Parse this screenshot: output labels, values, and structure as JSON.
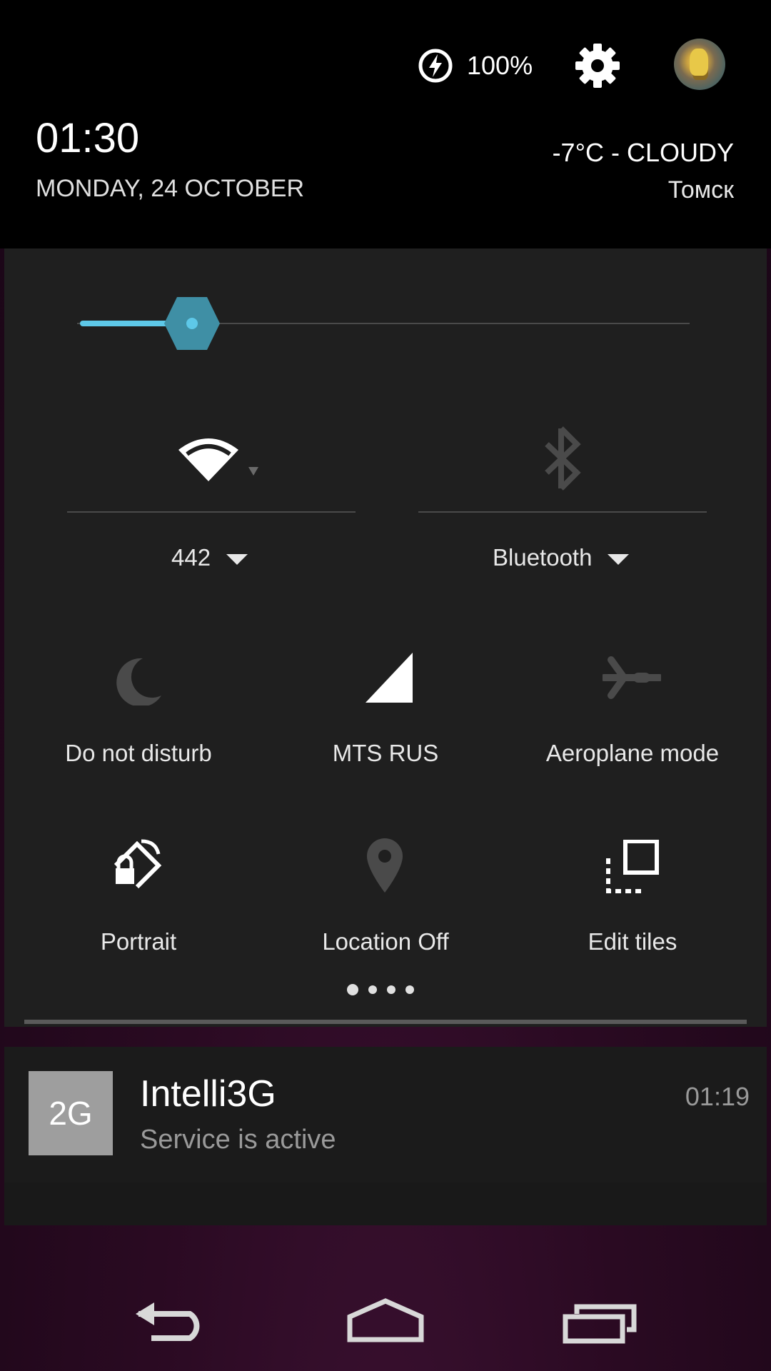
{
  "status": {
    "battery_text": "100%",
    "time": "01:30",
    "date": "MONDAY, 24 OCTOBER",
    "weather": "-7°C - CLOUDY",
    "city": "Томск"
  },
  "brightness": {
    "level_fraction": 0.15,
    "accent_color": "#5ec8e8"
  },
  "toggles": {
    "wifi": {
      "label": "442",
      "icon": "wifi-icon",
      "state": "on"
    },
    "bluetooth": {
      "label": "Bluetooth",
      "icon": "bluetooth-icon",
      "state": "off"
    }
  },
  "tiles": [
    {
      "label": "Do not disturb",
      "icon": "moon-icon",
      "state": "off"
    },
    {
      "label": "MTS RUS",
      "icon": "cell-signal-icon",
      "state": "on"
    },
    {
      "label": "Aeroplane mode",
      "icon": "airplane-icon",
      "state": "off"
    },
    {
      "label": "Portrait",
      "icon": "rotation-lock-icon",
      "state": "on"
    },
    {
      "label": "Location Off",
      "icon": "location-pin-icon",
      "state": "off"
    },
    {
      "label": "Edit tiles",
      "icon": "edit-tiles-icon",
      "state": "on"
    }
  ],
  "pages": {
    "count": 4,
    "current": 1
  },
  "notification": {
    "app_badge": "2G",
    "title": "Intelli3G",
    "text": "Service is active",
    "time": "01:19"
  }
}
